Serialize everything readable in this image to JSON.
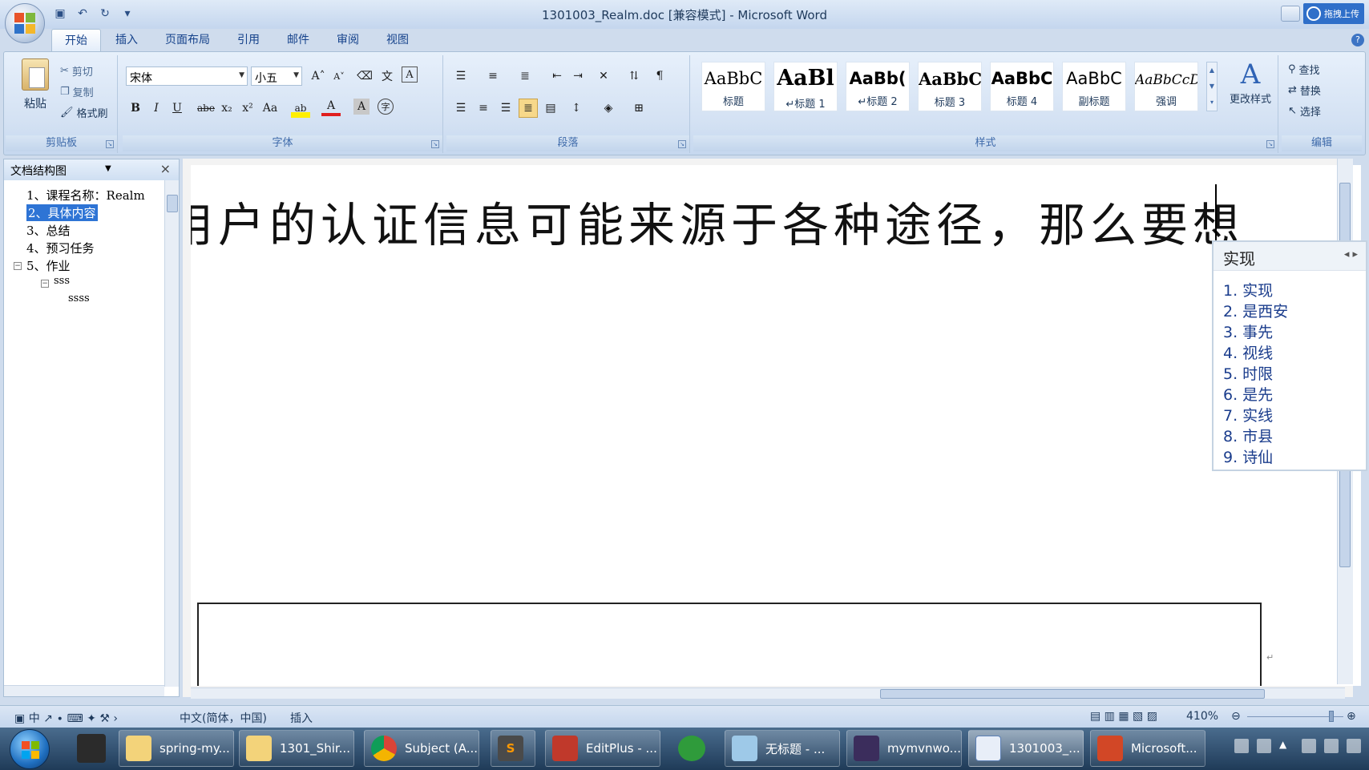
{
  "window": {
    "title": "1301003_Realm.doc [兼容模式] - Microsoft Word",
    "cloud_upload_label": "拖拽上传"
  },
  "ribbon_tabs": [
    "开始",
    "插入",
    "页面布局",
    "引用",
    "邮件",
    "审阅",
    "视图"
  ],
  "active_tab": "开始",
  "clipboard": {
    "paste_label": "粘贴",
    "cut_label": "剪切",
    "copy_label": "复制",
    "format_painter_label": "格式刷",
    "group_label": "剪贴板"
  },
  "font": {
    "name_value": "宋体",
    "size_value": "小五",
    "group_label": "字体",
    "bold": "B",
    "italic": "I",
    "underline": "U",
    "strike": "abe",
    "subscript": "x₂",
    "superscript": "x²",
    "change_case": "Aa",
    "grow": "A",
    "shrink": "A",
    "phonetic": "文",
    "char_border": "A",
    "font_color": "A",
    "char_shading": "A",
    "enclose": "字"
  },
  "paragraph": {
    "group_label": "段落"
  },
  "styles": {
    "group_label": "样式",
    "change_styles_label": "更改样式",
    "items": [
      {
        "sample": "AaBbC",
        "name": "标题"
      },
      {
        "sample": "AaBl",
        "name": "↵标题 1"
      },
      {
        "sample": "AaBb(",
        "name": "↵标题 2"
      },
      {
        "sample": "AaBbC",
        "name": "标题 3"
      },
      {
        "sample": "AaBbC",
        "name": "标题 4"
      },
      {
        "sample": "AaBbC",
        "name": "副标题"
      },
      {
        "sample": "AaBbCcDı",
        "name": "强调"
      }
    ]
  },
  "editing": {
    "group_label": "编辑",
    "find_label": "查找",
    "replace_label": "替换",
    "select_label": "选择"
  },
  "nav_pane": {
    "title": "文档结构图",
    "items": [
      {
        "label": "1、课程名称：Realm"
      },
      {
        "label": "2、具体内容"
      },
      {
        "label": "3、总结"
      },
      {
        "label": "4、预习任务"
      },
      {
        "label": "5、作业"
      },
      {
        "label": "sss"
      },
      {
        "label": "ssss"
      }
    ],
    "selected_index": 1
  },
  "document": {
    "text": "用户的认证信息可能来源于各种途径，那么要想"
  },
  "ime": {
    "composition": "实现",
    "candidates": [
      "1. 实现",
      "2. 是西安",
      "3. 事先",
      "4. 视线",
      "5. 时限",
      "6. 是先",
      "7. 实线",
      "8. 市县",
      "9. 诗仙"
    ]
  },
  "status_bar": {
    "ime_indicator": "中",
    "language": "中文(简体，中国)",
    "mode": "插入",
    "zoom": "410%"
  },
  "taskbar": {
    "items": [
      {
        "label": "spring-my..."
      },
      {
        "label": "1301_Shir..."
      },
      {
        "label": "Subject (A..."
      },
      {
        "label": "S"
      },
      {
        "label": "EditPlus - ..."
      },
      {
        "label": "无标题 - ..."
      },
      {
        "label": "mymvnwo..."
      },
      {
        "label": "1301003_..."
      },
      {
        "label": "Microsoft..."
      }
    ]
  },
  "colors": {
    "selection": "#2e74d5",
    "ribbon_bg": "#d3e1f3",
    "taskbar_bg": "#2a4868",
    "ime_candidate": "#1a3c8c"
  }
}
